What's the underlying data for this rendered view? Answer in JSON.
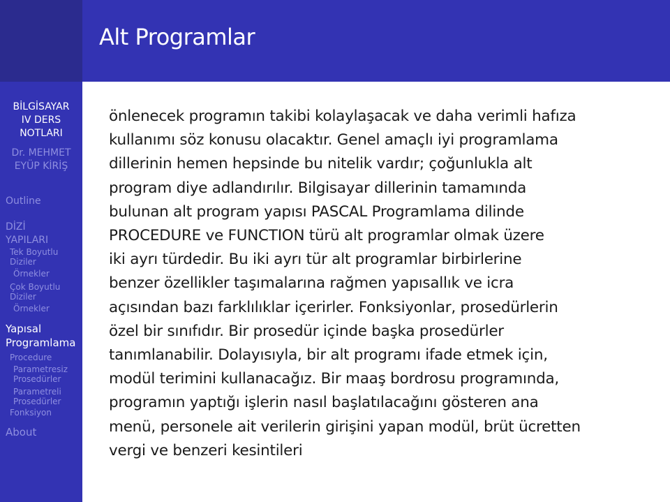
{
  "frame": {
    "title": "Alt Programlar"
  },
  "sidebar": {
    "presentation_title": [
      "BİLGİSAYAR",
      "IV DERS",
      "NOTLARI"
    ],
    "author": [
      "Dr. MEHMET",
      "EYÜP KİRİŞ"
    ],
    "sections": [
      {
        "label_lines": [
          "Outline"
        ],
        "current": false
      },
      {
        "label_lines": [
          "DİZİ",
          "YAPILARI"
        ],
        "current": false,
        "subsections": [
          {
            "label_lines": [
              "Tek Boyutlu",
              "Diziler"
            ]
          },
          {
            "label_lines": [
              "Örnekler"
            ],
            "level": 2
          },
          {
            "label_lines": [
              "Çok Boyutlu",
              "Diziler"
            ]
          },
          {
            "label_lines": [
              "Örnekler"
            ],
            "level": 2
          }
        ]
      },
      {
        "label_lines": [
          "Yapısal",
          "Programlama"
        ],
        "current": true,
        "subsections": [
          {
            "label_lines": [
              "Procedure"
            ]
          },
          {
            "label_lines": [
              "Parametresiz",
              "Prosedürler"
            ],
            "level": 2
          },
          {
            "label_lines": [
              "Parametreli",
              "Prosedürler"
            ],
            "level": 2
          },
          {
            "label_lines": [
              "Fonksiyon"
            ]
          }
        ]
      },
      {
        "label_lines": [
          "About"
        ],
        "current": false
      }
    ]
  },
  "body": {
    "lines": [
      "önlenecek programın takibi kolaylaşacak ve daha verimli hafıza",
      "kullanımı söz konusu olacaktır. Genel amaçlı iyi programlama",
      "dillerinin hemen hepsinde bu nitelik vardır; çoğunlukla alt",
      "program diye adlandırılır. Bilgisayar dillerinin tamamında",
      "bulunan alt program yapısı PASCAL Programlama dilinde",
      "PROCEDURE ve FUNCTION türü alt programlar olmak üzere",
      "iki ayrı türdedir. Bu iki ayrı tür alt programlar birbirlerine",
      "benzer özellikler taşımalarına rağmen yapısallık ve icra",
      "açısından bazı farklılıklar içerirler. Fonksiyonlar, prosedürlerin",
      "özel bir sınıfıdır. Bir prosedür içinde başka prosedürler",
      "tanımlanabilir. Dolayısıyla, bir alt programı ifade etmek için,",
      "modül terimini kullanacağız. Bir maaş bordrosu programında,",
      "programın yaptığı işlerin nasıl başlatılacağını gösteren ana",
      "menü, personele ait verilerin girişini yapan modül, brüt ücretten",
      "vergi ve benzeri kesintileri"
    ]
  },
  "colors": {
    "sidebar_bg": "#3333b3",
    "corner_bg": "#2b2b8e",
    "header_bg": "#3333b3",
    "sidebar_active_text": "#ffffff",
    "sidebar_inactive_text": "#8f8fe0",
    "body_text": "#1a1a1a"
  }
}
